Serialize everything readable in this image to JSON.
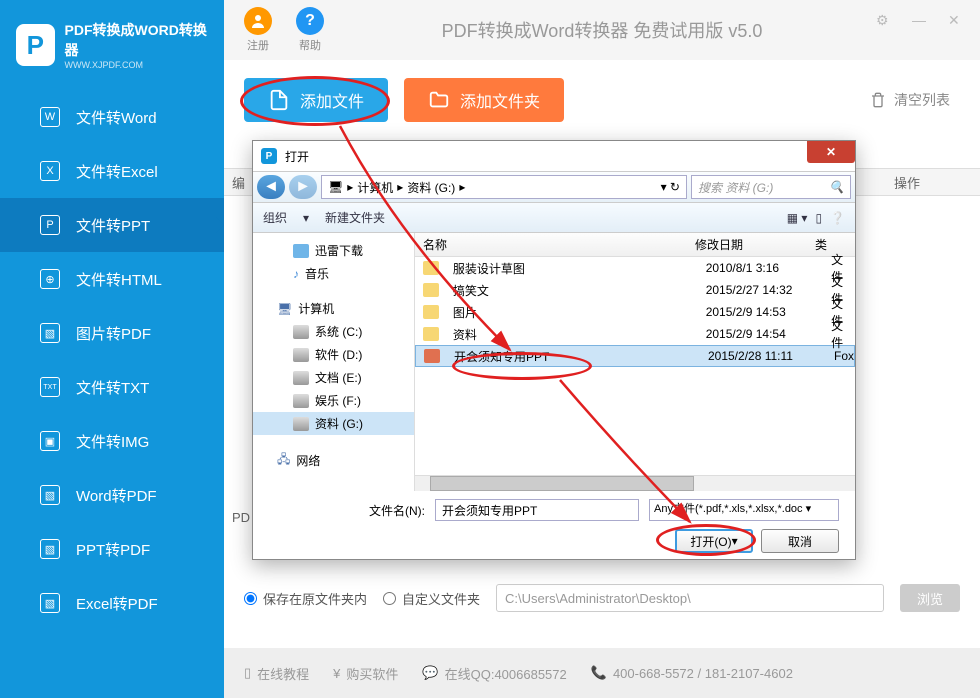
{
  "app": {
    "logo_title": "PDF转换成WORD转换器",
    "logo_url": "WWW.XJPDF.COM",
    "title": "PDF转换成Word转换器 免费试用版 v5.0",
    "register": "注册",
    "help": "帮助"
  },
  "sidebar": {
    "items": [
      {
        "icon": "W",
        "label": "文件转Word"
      },
      {
        "icon": "X",
        "label": "文件转Excel"
      },
      {
        "icon": "P",
        "label": "文件转PPT"
      },
      {
        "icon": "⊕",
        "label": "文件转HTML"
      },
      {
        "icon": "▧",
        "label": "图片转PDF"
      },
      {
        "icon": "TXT",
        "label": "文件转TXT"
      },
      {
        "icon": "▣",
        "label": "文件转IMG"
      },
      {
        "icon": "▧",
        "label": "Word转PDF"
      },
      {
        "icon": "▧",
        "label": "PPT转PDF"
      },
      {
        "icon": "▧",
        "label": "Excel转PDF"
      }
    ]
  },
  "toolbar": {
    "add_file": "添加文件",
    "add_folder": "添加文件夹",
    "clear": "清空列表"
  },
  "table_header_op": "操作",
  "table_header_edit": "编",
  "bottom": {
    "save_in_original": "保存在原文件夹内",
    "custom_folder": "自定义文件夹",
    "path": "C:\\Users\\Administrator\\Desktop\\",
    "browse": "浏览"
  },
  "footer": {
    "tutorial": "在线教程",
    "buy": "购买软件",
    "qq": "在线QQ:4006685572",
    "phone": "400-668-5572 / 181-2107-4602"
  },
  "dialog": {
    "title": "打开",
    "breadcrumb": {
      "computer": "计算机",
      "drive": "资料 (G:)"
    },
    "search_placeholder": "搜索 资料 (G:)",
    "organize": "组织",
    "new_folder": "新建文件夹",
    "tree": {
      "xunlei": "迅雷下载",
      "music": "音乐",
      "computer": "计算机",
      "drives": [
        {
          "label": "系统 (C:)"
        },
        {
          "label": "软件 (D:)"
        },
        {
          "label": "文档 (E:)"
        },
        {
          "label": "娱乐 (F:)"
        },
        {
          "label": "资料 (G:)"
        }
      ],
      "network": "网络"
    },
    "columns": {
      "name": "名称",
      "date": "修改日期",
      "type": "类"
    },
    "files": [
      {
        "name": "服装设计草图",
        "date": "2010/8/1 3:16",
        "type": "文件"
      },
      {
        "name": "搞笑文",
        "date": "2015/2/27 14:32",
        "type": "文件"
      },
      {
        "name": "图片",
        "date": "2015/2/9 14:53",
        "type": "文件"
      },
      {
        "name": "资料",
        "date": "2015/2/9 14:54",
        "type": "文件"
      },
      {
        "name": "开会须知专用PPT",
        "date": "2015/2/28 11:11",
        "type": "Fox"
      }
    ],
    "filename_label": "文件名(N):",
    "filename_value": "开会须知专用PPT",
    "filetype": "Any文件(*.pdf,*.xls,*.xlsx,*.doc",
    "open_btn": "打开(O)",
    "cancel_btn": "取消"
  },
  "pdf_label": "PD"
}
